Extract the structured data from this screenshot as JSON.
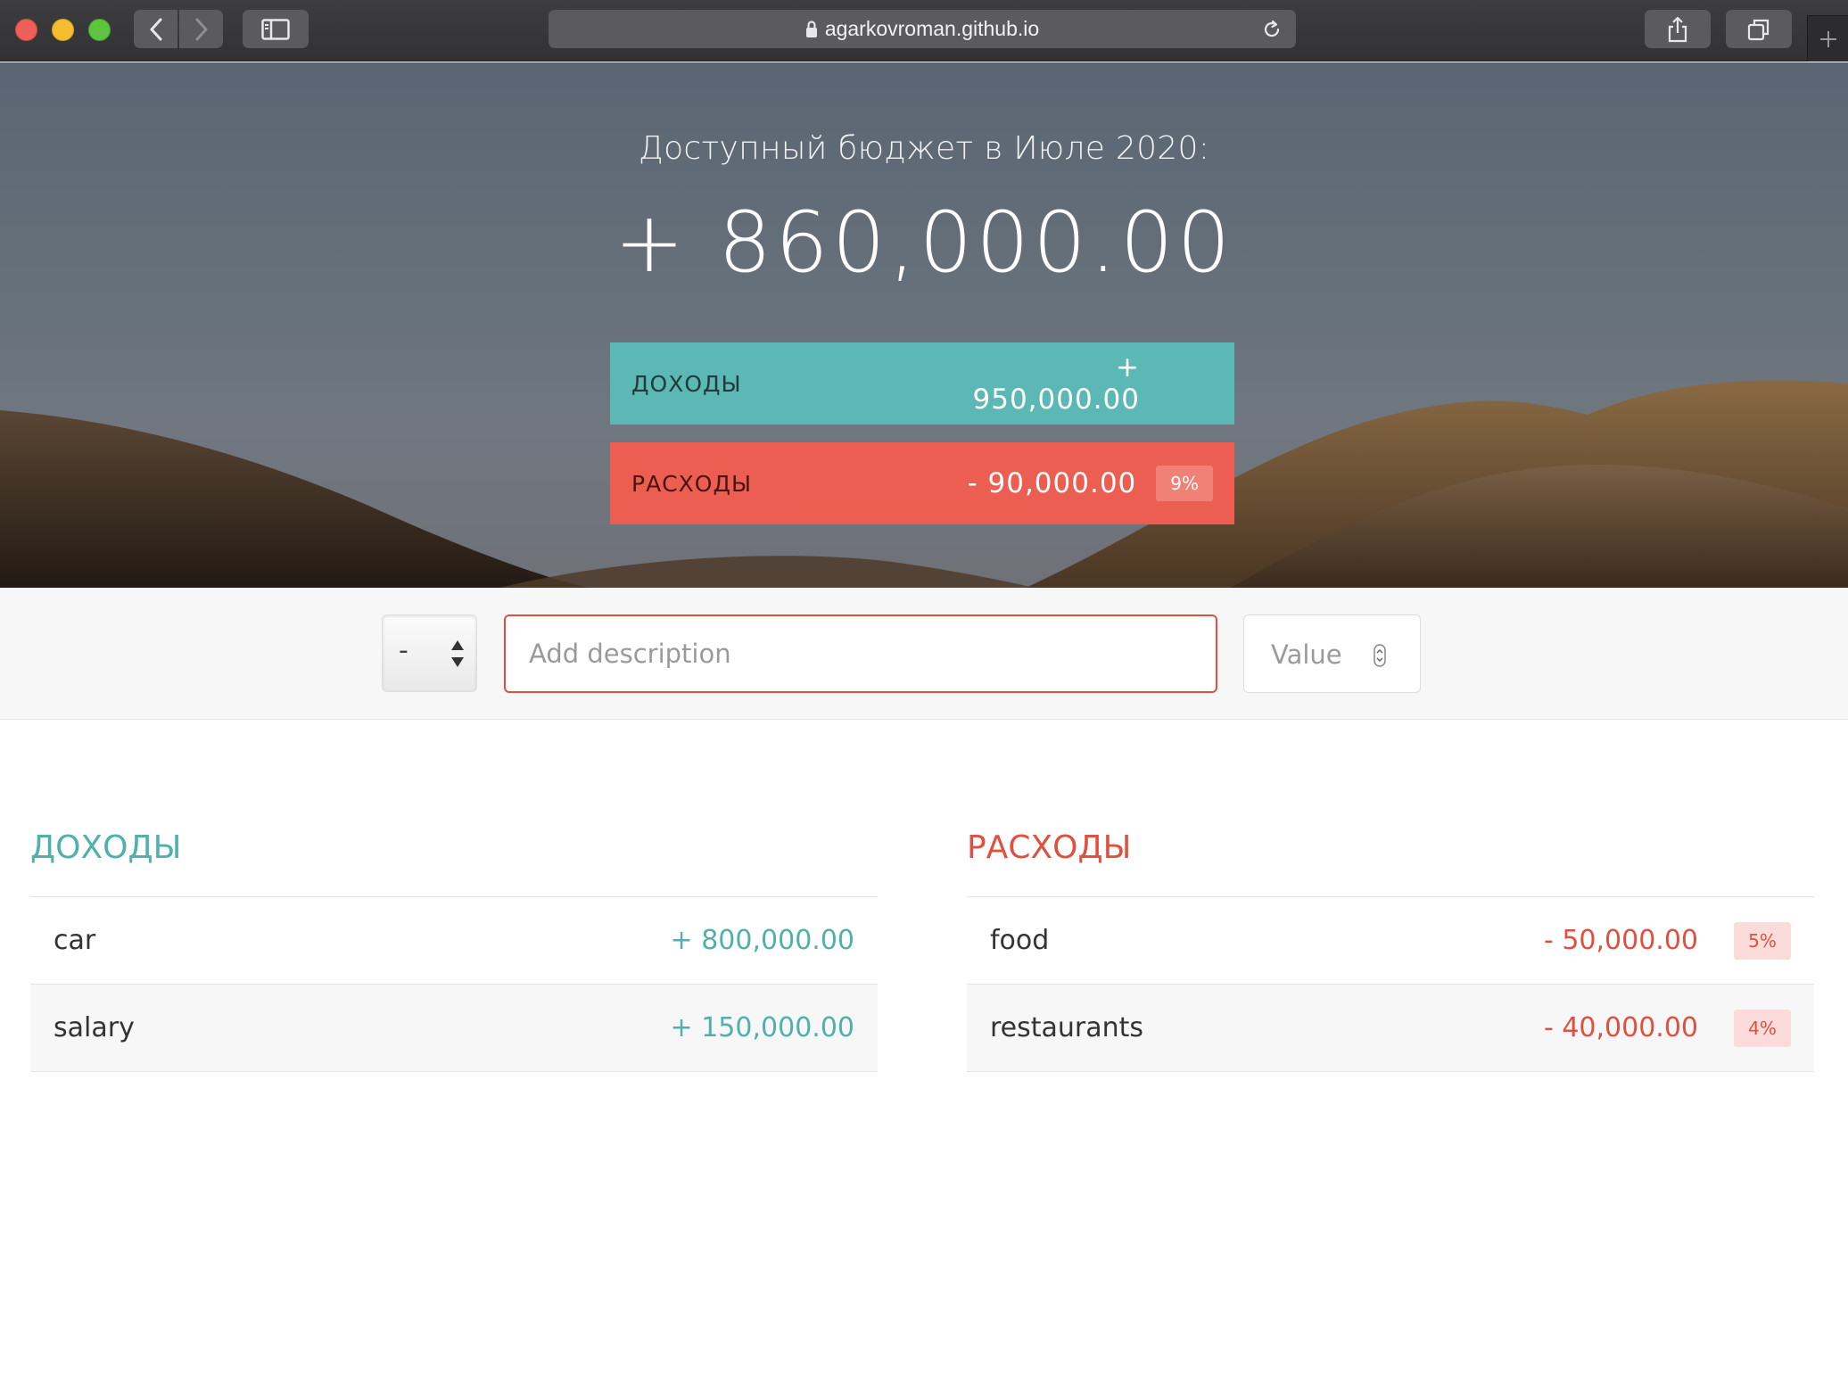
{
  "browser": {
    "url": "agarkovroman.github.io"
  },
  "hero": {
    "title": "Доступный бюджет в Июле 2020:",
    "budget": "+ 860,000.00",
    "income_label": "ДОХОДЫ",
    "income_value": "+ 950,000.00",
    "expense_label": "РАСХОДЫ",
    "expense_value": "- 90,000.00",
    "expense_percent": "9%"
  },
  "add_form": {
    "type_value": "-",
    "description_placeholder": "Add description",
    "value_placeholder": "Value"
  },
  "income": {
    "title": "ДОХОДЫ",
    "items": [
      {
        "description": "car",
        "value": "+ 800,000.00"
      },
      {
        "description": "salary",
        "value": "+ 150,000.00"
      }
    ]
  },
  "expenses": {
    "title": "РАСХОДЫ",
    "items": [
      {
        "description": "food",
        "value": "- 50,000.00",
        "percent": "5%"
      },
      {
        "description": "restaurants",
        "value": "- 40,000.00",
        "percent": "4%"
      }
    ]
  },
  "colors": {
    "income": "#5bb8b5",
    "expense": "#eb5e51",
    "input_focus": "#e0503f"
  }
}
